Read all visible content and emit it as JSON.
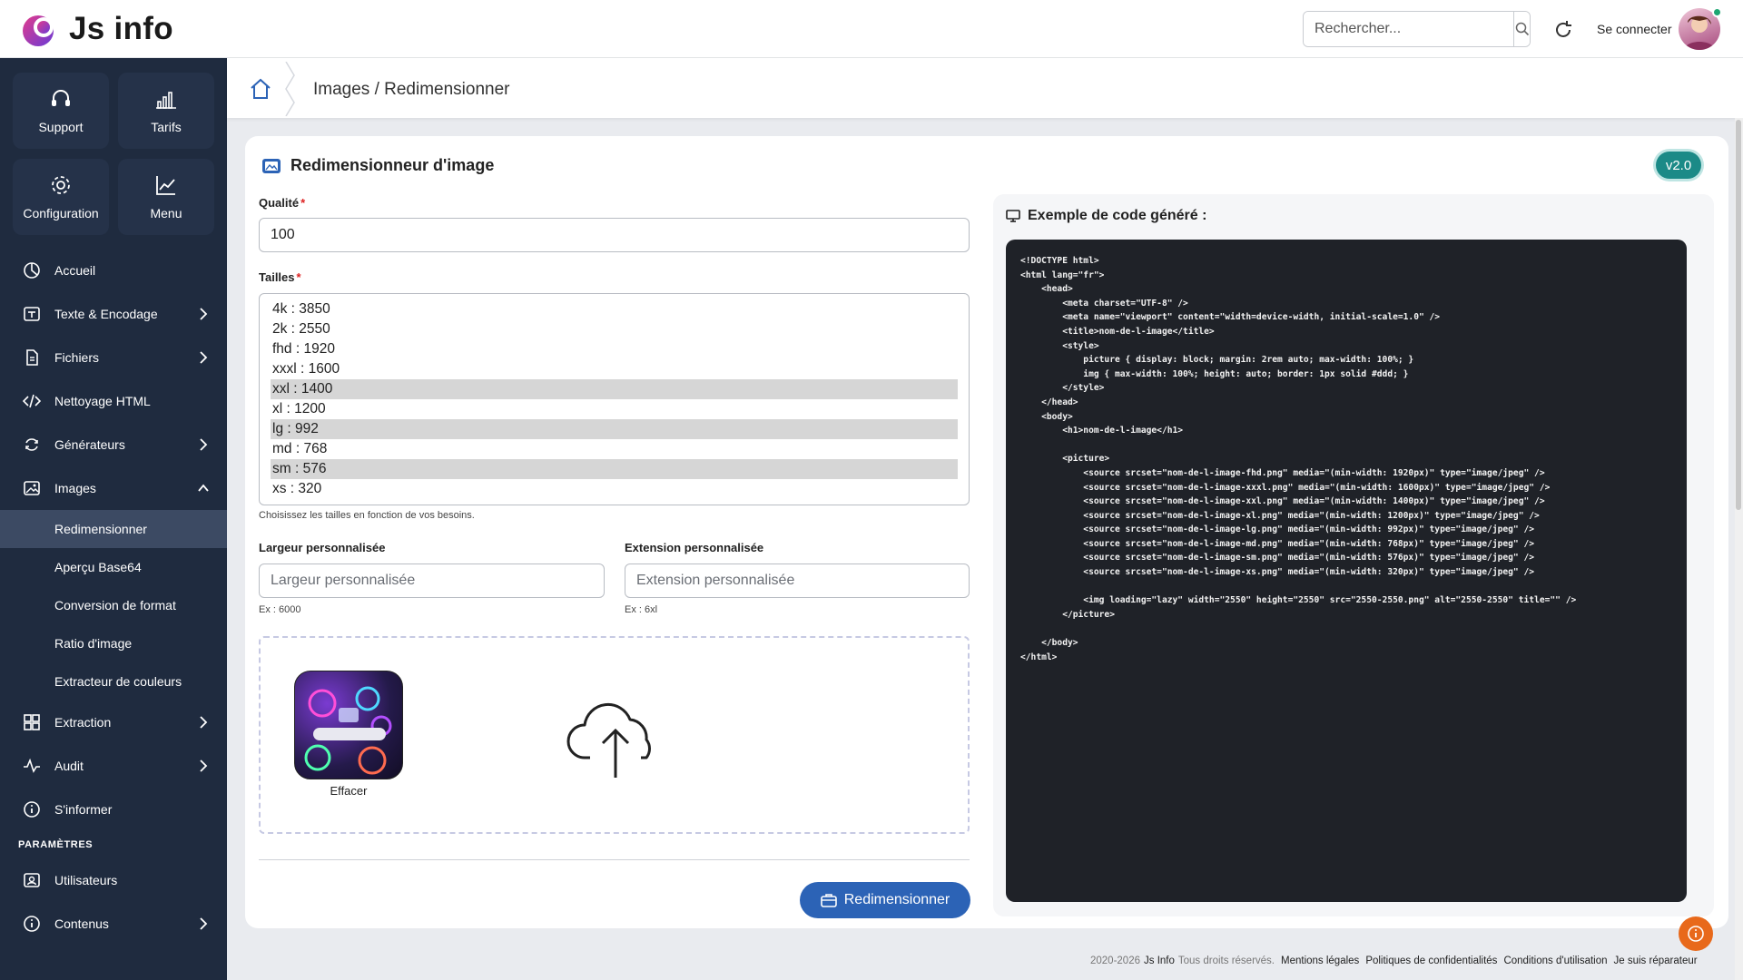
{
  "app": {
    "title": "Js info"
  },
  "header": {
    "search_placeholder": "Rechercher...",
    "login_label": "Se connecter"
  },
  "sidebar": {
    "tiles": [
      {
        "label": "Support",
        "icon": "headset-icon"
      },
      {
        "label": "Tarifs",
        "icon": "bar-chart-icon"
      },
      {
        "label": "Configuration",
        "icon": "gear-icon"
      },
      {
        "label": "Menu",
        "icon": "trend-chart-icon"
      }
    ],
    "items": [
      {
        "label": "Accueil",
        "icon": "pie-icon"
      },
      {
        "label": "Texte & Encodage",
        "icon": "text-icon"
      },
      {
        "label": "Fichiers",
        "icon": "file-icon"
      },
      {
        "label": "Nettoyage HTML",
        "icon": "code-icon"
      },
      {
        "label": "Générateurs",
        "icon": "cycle-icon"
      },
      {
        "label": "Images",
        "icon": "image-icon"
      }
    ],
    "image_sub": [
      {
        "label": "Redimensionner",
        "active": true
      },
      {
        "label": "Aperçu Base64"
      },
      {
        "label": "Conversion de format"
      },
      {
        "label": "Ratio d'image"
      },
      {
        "label": "Extracteur de couleurs"
      }
    ],
    "items2": [
      {
        "label": "Extraction",
        "icon": "grid-icon"
      },
      {
        "label": "Audit",
        "icon": "pulse-icon"
      },
      {
        "label": "S'informer",
        "icon": "info-icon"
      }
    ],
    "settings_title": "PARAMÈTRES",
    "settings_items": [
      {
        "label": "Utilisateurs",
        "icon": "user-card-icon"
      },
      {
        "label": "Contenus",
        "icon": "info-icon"
      }
    ]
  },
  "breadcrumb": {
    "text": "Images / Redimensionner"
  },
  "card": {
    "title": "Redimensionneur d'image",
    "version": "v2.0",
    "quality_label": "Qualité",
    "quality_value": "100",
    "sizes_label": "Tailles",
    "sizes": [
      {
        "label": "4k : 3850",
        "selected": false
      },
      {
        "label": "2k : 2550",
        "selected": false
      },
      {
        "label": "fhd : 1920",
        "selected": false
      },
      {
        "label": "xxxl : 1600",
        "selected": false
      },
      {
        "label": "xxl : 1400",
        "selected": true
      },
      {
        "label": "xl : 1200",
        "selected": false
      },
      {
        "label": "lg : 992",
        "selected": true
      },
      {
        "label": "md : 768",
        "selected": false
      },
      {
        "label": "sm : 576",
        "selected": true
      },
      {
        "label": "xs : 320",
        "selected": false
      }
    ],
    "sizes_hint": "Choisissez les tailles en fonction de vos besoins.",
    "width_label": "Largeur personnalisée",
    "width_placeholder": "Largeur personnalisée",
    "width_hint": "Ex : 6000",
    "ext_label": "Extension personnalisée",
    "ext_placeholder": "Extension personnalisée",
    "ext_hint": "Ex : 6xl",
    "thumb_caption": "Effacer",
    "resize_button": "Redimensionner",
    "code_title": "Exemple de code généré :",
    "code": "<!DOCTYPE html>\n<html lang=\"fr\">\n    <head>\n        <meta charset=\"UTF-8\" />\n        <meta name=\"viewport\" content=\"width=device-width, initial-scale=1.0\" />\n        <title>nom-de-l-image</title>\n        <style>\n            picture { display: block; margin: 2rem auto; max-width: 100%; }\n            img { max-width: 100%; height: auto; border: 1px solid #ddd; }\n        </style>\n    </head>\n    <body>\n        <h1>nom-de-l-image</h1>\n\n        <picture>\n            <source srcset=\"nom-de-l-image-fhd.png\" media=\"(min-width: 1920px)\" type=\"image/jpeg\" />\n            <source srcset=\"nom-de-l-image-xxxl.png\" media=\"(min-width: 1600px)\" type=\"image/jpeg\" />\n            <source srcset=\"nom-de-l-image-xxl.png\" media=\"(min-width: 1400px)\" type=\"image/jpeg\" />\n            <source srcset=\"nom-de-l-image-xl.png\" media=\"(min-width: 1200px)\" type=\"image/jpeg\" />\n            <source srcset=\"nom-de-l-image-lg.png\" media=\"(min-width: 992px)\" type=\"image/jpeg\" />\n            <source srcset=\"nom-de-l-image-md.png\" media=\"(min-width: 768px)\" type=\"image/jpeg\" />\n            <source srcset=\"nom-de-l-image-sm.png\" media=\"(min-width: 576px)\" type=\"image/jpeg\" />\n            <source srcset=\"nom-de-l-image-xs.png\" media=\"(min-width: 320px)\" type=\"image/jpeg\" />\n\n            <img loading=\"lazy\" width=\"2550\" height=\"2550\" src=\"2550-2550.png\" alt=\"2550-2550\" title=\"\" />\n        </picture>\n\n    </body>\n</html>"
  },
  "footer": {
    "copyright": "2020-2026",
    "brand": "Js Info",
    "rights": "Tous droits réservés.",
    "links": [
      "Mentions légales",
      "Politiques de confidentialités",
      "Conditions d'utilisation",
      "Je suis réparateur"
    ]
  },
  "colors": {
    "sidebar_bg": "#1f2b3f",
    "accent_blue": "#2c63b6",
    "version_teal": "#1b8a87",
    "fab_orange": "#e8691b"
  }
}
